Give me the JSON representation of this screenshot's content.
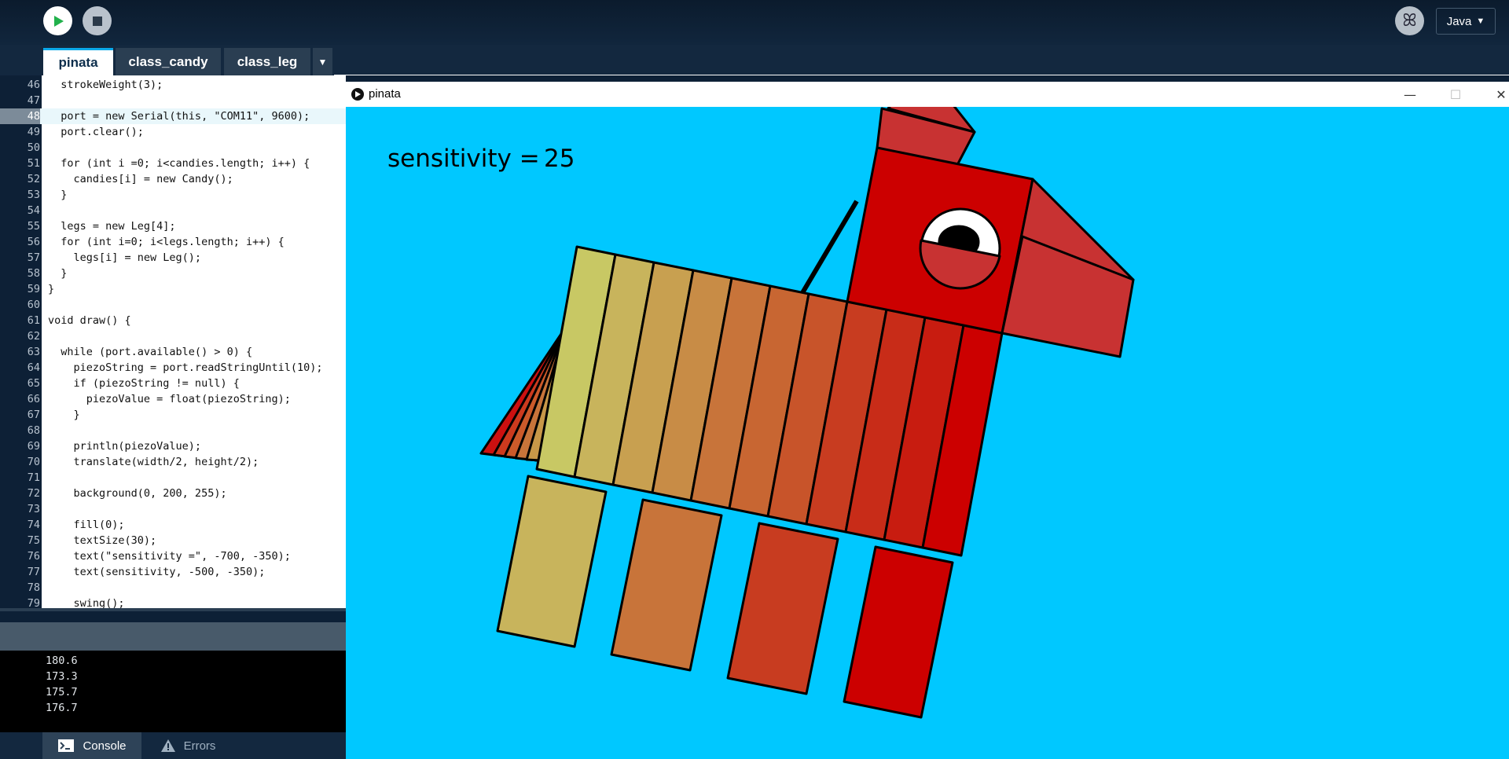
{
  "toolbar": {
    "run_icon": "play-icon",
    "stop_icon": "stop-icon",
    "debug_icon": "butterfly-icon",
    "mode_label": "Java"
  },
  "tabs": [
    {
      "label": "pinata",
      "active": true
    },
    {
      "label": "class_candy",
      "active": false
    },
    {
      "label": "class_leg",
      "active": false
    }
  ],
  "editor": {
    "current_line": 48,
    "lines": [
      {
        "n": "46",
        "code": "  strokeWeight(3);"
      },
      {
        "n": "47",
        "code": ""
      },
      {
        "n": "48",
        "code": "  port = new Serial(this, \"COM11\", 9600);"
      },
      {
        "n": "49",
        "code": "  port.clear();"
      },
      {
        "n": "50",
        "code": ""
      },
      {
        "n": "51",
        "code": "  for (int i =0; i<candies.length; i++) {"
      },
      {
        "n": "52",
        "code": "    candies[i] = new Candy();"
      },
      {
        "n": "53",
        "code": "  }"
      },
      {
        "n": "54",
        "code": ""
      },
      {
        "n": "55",
        "code": "  legs = new Leg[4];"
      },
      {
        "n": "56",
        "code": "  for (int i=0; i<legs.length; i++) {"
      },
      {
        "n": "57",
        "code": "    legs[i] = new Leg();"
      },
      {
        "n": "58",
        "code": "  }"
      },
      {
        "n": "59",
        "code": "}"
      },
      {
        "n": "60",
        "code": ""
      },
      {
        "n": "61",
        "code": "void draw() {"
      },
      {
        "n": "62",
        "code": ""
      },
      {
        "n": "63",
        "code": "  while (port.available() > 0) {"
      },
      {
        "n": "64",
        "code": "    piezoString = port.readStringUntil(10);"
      },
      {
        "n": "65",
        "code": "    if (piezoString != null) {"
      },
      {
        "n": "66",
        "code": "      piezoValue = float(piezoString);"
      },
      {
        "n": "67",
        "code": "    }"
      },
      {
        "n": "68",
        "code": ""
      },
      {
        "n": "69",
        "code": "    println(piezoValue);"
      },
      {
        "n": "70",
        "code": "    translate(width/2, height/2);"
      },
      {
        "n": "71",
        "code": ""
      },
      {
        "n": "72",
        "code": "    background(0, 200, 255);"
      },
      {
        "n": "73",
        "code": ""
      },
      {
        "n": "74",
        "code": "    fill(0);"
      },
      {
        "n": "75",
        "code": "    textSize(30);"
      },
      {
        "n": "76",
        "code": "    text(\"sensitivity =\", -700, -350);"
      },
      {
        "n": "77",
        "code": "    text(sensitivity, -500, -350);"
      },
      {
        "n": "78",
        "code": ""
      },
      {
        "n": "79",
        "code": "    swing();"
      }
    ]
  },
  "console": {
    "lines": [
      "180.6",
      "173.3",
      "175.7",
      "176.7"
    ]
  },
  "footer": {
    "console_label": "Console",
    "errors_label": "Errors"
  },
  "sketch": {
    "window_title": "pinata",
    "sensitivity_label": "sensitivity = ",
    "sensitivity_value": "25",
    "background_color": "#00c8ff"
  }
}
